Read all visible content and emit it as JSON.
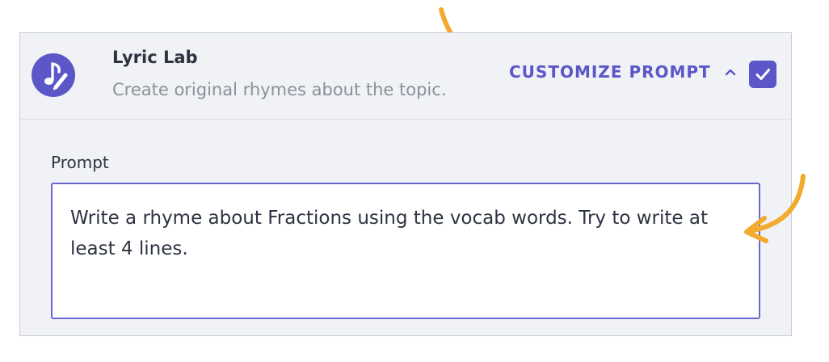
{
  "header": {
    "title": "Lyric Lab",
    "subtitle": "Create original rhymes about the topic.",
    "customize_label": "CUSTOMIZE PROMPT",
    "app_icon": "music-note-pencil-icon",
    "chevron_icon": "chevron-up-icon",
    "checkbox_checked": true
  },
  "prompt": {
    "label": "Prompt",
    "value": "Write a rhyme about Fractions using the vocab words. Try to write at least 4 lines."
  },
  "colors": {
    "accent": "#5b57c9",
    "arrow": "#f2ab2c",
    "panel": "#f0f2f5",
    "title_text": "#2d3340",
    "muted_text": "#8a909a"
  }
}
